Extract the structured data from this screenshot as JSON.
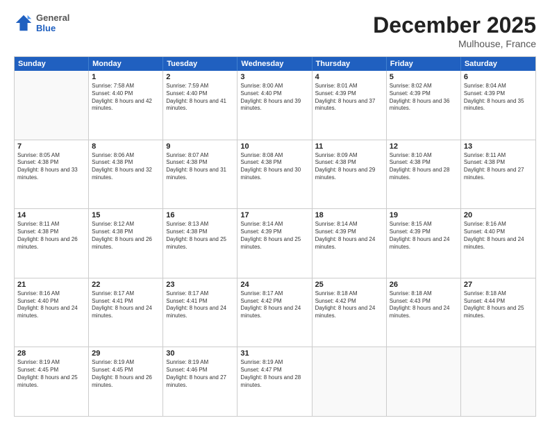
{
  "header": {
    "logo": {
      "general": "General",
      "blue": "Blue"
    },
    "title": "December 2025",
    "location": "Mulhouse, France"
  },
  "calendar": {
    "days_of_week": [
      "Sunday",
      "Monday",
      "Tuesday",
      "Wednesday",
      "Thursday",
      "Friday",
      "Saturday"
    ],
    "rows": [
      [
        {
          "day": "",
          "empty": true
        },
        {
          "day": "1",
          "sunrise": "7:58 AM",
          "sunset": "4:40 PM",
          "daylight": "8 hours and 42 minutes."
        },
        {
          "day": "2",
          "sunrise": "7:59 AM",
          "sunset": "4:40 PM",
          "daylight": "8 hours and 41 minutes."
        },
        {
          "day": "3",
          "sunrise": "8:00 AM",
          "sunset": "4:40 PM",
          "daylight": "8 hours and 39 minutes."
        },
        {
          "day": "4",
          "sunrise": "8:01 AM",
          "sunset": "4:39 PM",
          "daylight": "8 hours and 37 minutes."
        },
        {
          "day": "5",
          "sunrise": "8:02 AM",
          "sunset": "4:39 PM",
          "daylight": "8 hours and 36 minutes."
        },
        {
          "day": "6",
          "sunrise": "8:04 AM",
          "sunset": "4:39 PM",
          "daylight": "8 hours and 35 minutes."
        }
      ],
      [
        {
          "day": "7",
          "sunrise": "8:05 AM",
          "sunset": "4:38 PM",
          "daylight": "8 hours and 33 minutes."
        },
        {
          "day": "8",
          "sunrise": "8:06 AM",
          "sunset": "4:38 PM",
          "daylight": "8 hours and 32 minutes."
        },
        {
          "day": "9",
          "sunrise": "8:07 AM",
          "sunset": "4:38 PM",
          "daylight": "8 hours and 31 minutes."
        },
        {
          "day": "10",
          "sunrise": "8:08 AM",
          "sunset": "4:38 PM",
          "daylight": "8 hours and 30 minutes."
        },
        {
          "day": "11",
          "sunrise": "8:09 AM",
          "sunset": "4:38 PM",
          "daylight": "8 hours and 29 minutes."
        },
        {
          "day": "12",
          "sunrise": "8:10 AM",
          "sunset": "4:38 PM",
          "daylight": "8 hours and 28 minutes."
        },
        {
          "day": "13",
          "sunrise": "8:11 AM",
          "sunset": "4:38 PM",
          "daylight": "8 hours and 27 minutes."
        }
      ],
      [
        {
          "day": "14",
          "sunrise": "8:11 AM",
          "sunset": "4:38 PM",
          "daylight": "8 hours and 26 minutes."
        },
        {
          "day": "15",
          "sunrise": "8:12 AM",
          "sunset": "4:38 PM",
          "daylight": "8 hours and 26 minutes."
        },
        {
          "day": "16",
          "sunrise": "8:13 AM",
          "sunset": "4:38 PM",
          "daylight": "8 hours and 25 minutes."
        },
        {
          "day": "17",
          "sunrise": "8:14 AM",
          "sunset": "4:39 PM",
          "daylight": "8 hours and 25 minutes."
        },
        {
          "day": "18",
          "sunrise": "8:14 AM",
          "sunset": "4:39 PM",
          "daylight": "8 hours and 24 minutes."
        },
        {
          "day": "19",
          "sunrise": "8:15 AM",
          "sunset": "4:39 PM",
          "daylight": "8 hours and 24 minutes."
        },
        {
          "day": "20",
          "sunrise": "8:16 AM",
          "sunset": "4:40 PM",
          "daylight": "8 hours and 24 minutes."
        }
      ],
      [
        {
          "day": "21",
          "sunrise": "8:16 AM",
          "sunset": "4:40 PM",
          "daylight": "8 hours and 24 minutes."
        },
        {
          "day": "22",
          "sunrise": "8:17 AM",
          "sunset": "4:41 PM",
          "daylight": "8 hours and 24 minutes."
        },
        {
          "day": "23",
          "sunrise": "8:17 AM",
          "sunset": "4:41 PM",
          "daylight": "8 hours and 24 minutes."
        },
        {
          "day": "24",
          "sunrise": "8:17 AM",
          "sunset": "4:42 PM",
          "daylight": "8 hours and 24 minutes."
        },
        {
          "day": "25",
          "sunrise": "8:18 AM",
          "sunset": "4:42 PM",
          "daylight": "8 hours and 24 minutes."
        },
        {
          "day": "26",
          "sunrise": "8:18 AM",
          "sunset": "4:43 PM",
          "daylight": "8 hours and 24 minutes."
        },
        {
          "day": "27",
          "sunrise": "8:18 AM",
          "sunset": "4:44 PM",
          "daylight": "8 hours and 25 minutes."
        }
      ],
      [
        {
          "day": "28",
          "sunrise": "8:19 AM",
          "sunset": "4:45 PM",
          "daylight": "8 hours and 25 minutes."
        },
        {
          "day": "29",
          "sunrise": "8:19 AM",
          "sunset": "4:45 PM",
          "daylight": "8 hours and 26 minutes."
        },
        {
          "day": "30",
          "sunrise": "8:19 AM",
          "sunset": "4:46 PM",
          "daylight": "8 hours and 27 minutes."
        },
        {
          "day": "31",
          "sunrise": "8:19 AM",
          "sunset": "4:47 PM",
          "daylight": "8 hours and 28 minutes."
        },
        {
          "day": "",
          "empty": true
        },
        {
          "day": "",
          "empty": true
        },
        {
          "day": "",
          "empty": true
        }
      ]
    ]
  }
}
